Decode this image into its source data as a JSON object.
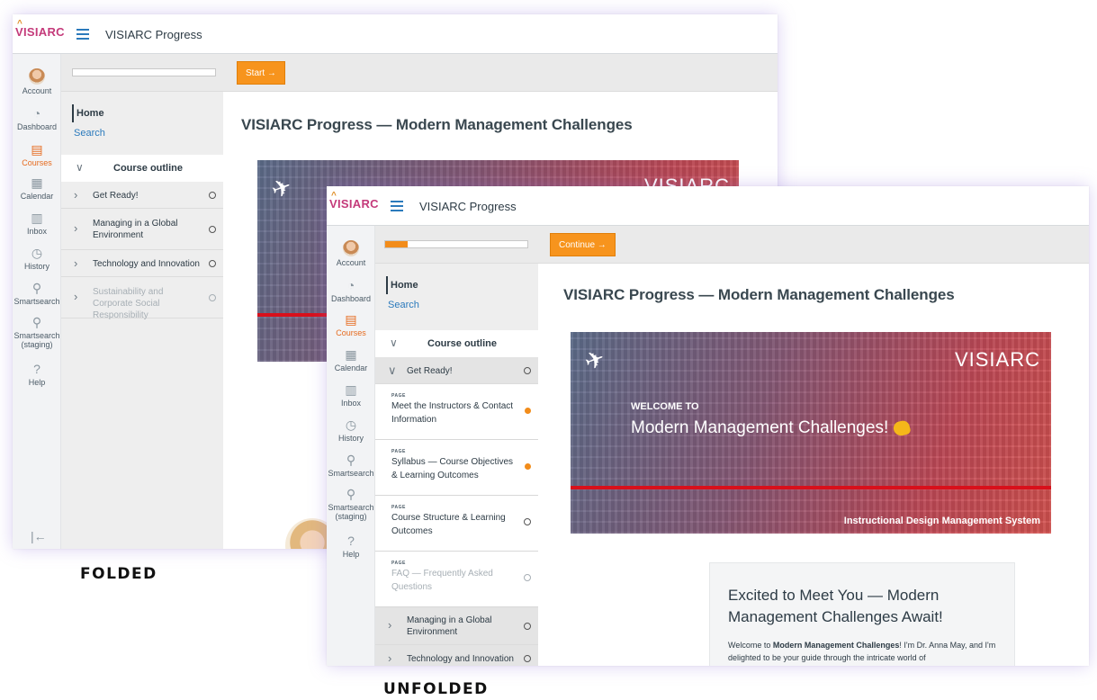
{
  "folded": {
    "app_title": "VISIARC Progress",
    "logo_text": "VISIARC",
    "nav": [
      {
        "label": "Account",
        "icon": "avatar"
      },
      {
        "label": "Dashboard",
        "icon": "dashboard-icon"
      },
      {
        "label": "Courses",
        "icon": "courses-icon",
        "active": true
      },
      {
        "label": "Calendar",
        "icon": "calendar-icon"
      },
      {
        "label": "Inbox",
        "icon": "inbox-icon"
      },
      {
        "label": "History",
        "icon": "history-icon"
      },
      {
        "label": "Smartsearch",
        "icon": "search-icon"
      },
      {
        "label": "Smartsearch (staging)",
        "icon": "search-icon"
      },
      {
        "label": "Help",
        "icon": "help-icon"
      }
    ],
    "progress": 0,
    "cta_label": "Start →",
    "home_label": "Home",
    "search_label": "Search",
    "outline_label": "Course outline",
    "modules": [
      {
        "title": "Get Ready!"
      },
      {
        "title": "Managing in a Global Environment"
      },
      {
        "title": "Technology and Innovation"
      },
      {
        "title": "Sustainability and Corporate Social Responsibility",
        "dim": true
      }
    ],
    "main_title": "VISIARC Progress — Modern Management Challenges",
    "hero_logo": "VISIARC"
  },
  "unfolded": {
    "app_title": "VISIARC Progress",
    "logo_text": "VISIARC",
    "nav": [
      {
        "label": "Account"
      },
      {
        "label": "Dashboard"
      },
      {
        "label": "Courses",
        "active": true
      },
      {
        "label": "Calendar"
      },
      {
        "label": "Inbox"
      },
      {
        "label": "History"
      },
      {
        "label": "Smartsearch"
      },
      {
        "label": "Smartsearch (staging)"
      },
      {
        "label": "Help"
      }
    ],
    "progress": 0.16,
    "cta_label": "Continue →",
    "home_label": "Home",
    "search_label": "Search",
    "outline_label": "Course outline",
    "expanded_module": "Get Ready!",
    "pages": [
      {
        "kind": "PAGE",
        "title": "Meet the Instructors & Contact Information",
        "status": "in-progress"
      },
      {
        "kind": "PAGE",
        "title": "Syllabus — Course Objectives & Learning Outcomes",
        "status": "in-progress"
      },
      {
        "kind": "PAGE",
        "title": "Course Structure & Learning Outcomes",
        "status": "not-started"
      },
      {
        "kind": "PAGE",
        "title": "FAQ — Frequently Asked Questions",
        "status": "not-started",
        "dim": true
      }
    ],
    "modules_after": [
      {
        "title": "Managing in a Global Environment"
      },
      {
        "title": "Technology and Innovation"
      }
    ],
    "main_title": "VISIARC Progress — Modern Management Challenges",
    "hero": {
      "logo": "VISIARC",
      "welcome": "WELCOME TO",
      "heading": "Modern Management Challenges!",
      "tagline": "Instructional Design Management System"
    },
    "card": {
      "title": "Excited to Meet You — Modern Management Challenges Await!",
      "body_prefix": "Welcome to ",
      "body_bold": "Modern Management Challenges",
      "body_suffix": "! I'm Dr. Anna May, and I'm delighted to be your guide through the intricate world of"
    }
  },
  "captions": {
    "folded": "FOLDED",
    "unfolded": "UNFOLDED"
  },
  "colors": {
    "accent_orange": "#f7941d",
    "link_blue": "#2b7abc",
    "hero_red": "#d8101b"
  }
}
